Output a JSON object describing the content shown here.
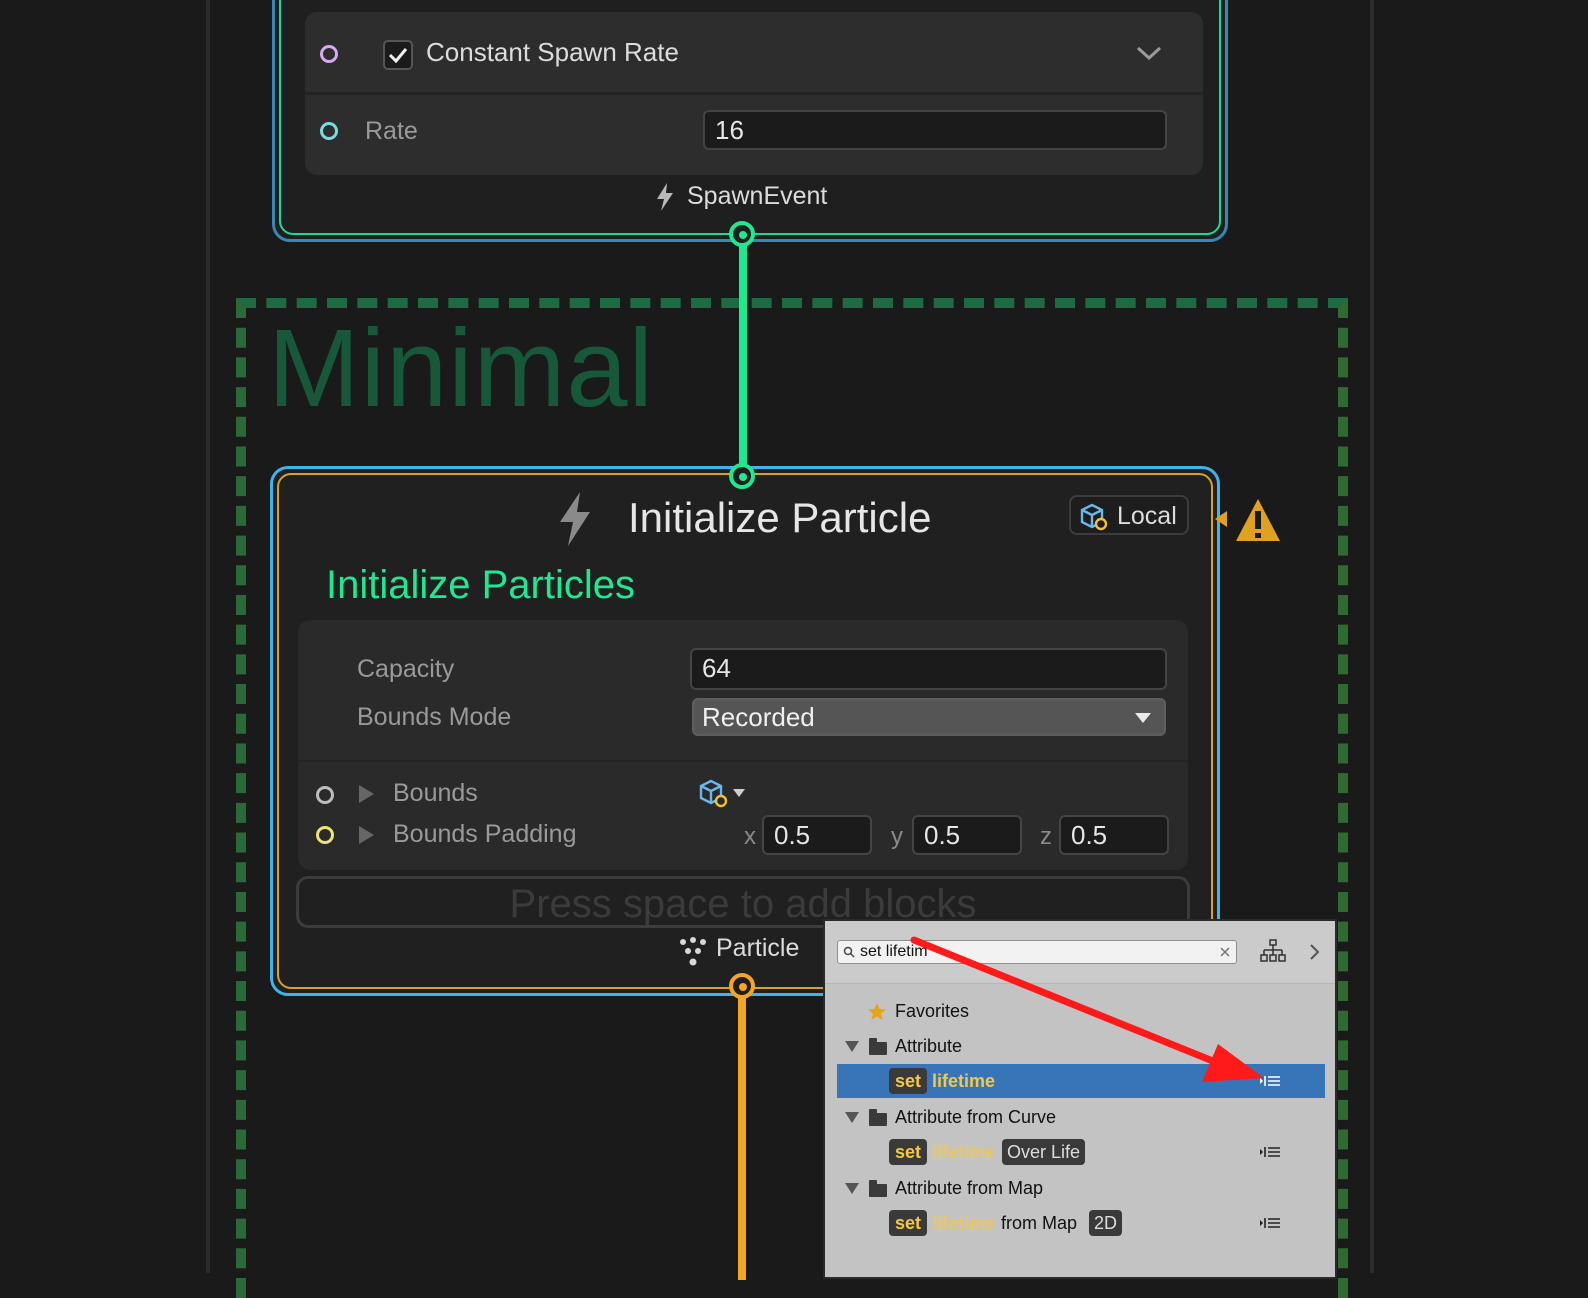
{
  "spawn": {
    "block_title": "Constant Spawn Rate",
    "rate_label": "Rate",
    "rate_value": "16",
    "event_label": "SpawnEvent"
  },
  "group": {
    "title": "Minimal"
  },
  "init": {
    "title": "Initialize Particle",
    "subtitle": "Initialize Particles",
    "space_label": "Local",
    "capacity_label": "Capacity",
    "capacity_value": "64",
    "bounds_mode_label": "Bounds Mode",
    "bounds_mode_value": "Recorded",
    "bounds_label": "Bounds",
    "bounds_padding_label": "Bounds Padding",
    "padding": {
      "x_label": "x",
      "x": "0.5",
      "y_label": "y",
      "y": "0.5",
      "z_label": "z",
      "z": "0.5"
    },
    "add_blocks_hint": "Press space to add blocks",
    "output_label": "Particle"
  },
  "search_popup": {
    "query": "set lifetim",
    "items": [
      {
        "type": "favorites",
        "label": "Favorites"
      },
      {
        "type": "folder",
        "label": "Attribute"
      },
      {
        "type": "entry",
        "set": "set",
        "attr": "lifetime",
        "selected": true
      },
      {
        "type": "folder",
        "label": "Attribute from Curve"
      },
      {
        "type": "entry",
        "set": "set",
        "attr": "lifetime",
        "suffix": "Over Life"
      },
      {
        "type": "folder",
        "label": "Attribute from Map"
      },
      {
        "type": "entry",
        "set": "set",
        "attr": "lifetime",
        "mid": "from Map",
        "suffix": "2D"
      }
    ]
  },
  "colors": {
    "spawn_border": "#3a86b5",
    "flow_green": "#1ee890",
    "init_border": "#3fb4ea",
    "particle_orange": "#f4a623",
    "group_dash": "#1e6b43",
    "selection_blue": "#3874b8",
    "warning": "#e0a020",
    "annotation_arrow": "#ff1a1a"
  }
}
